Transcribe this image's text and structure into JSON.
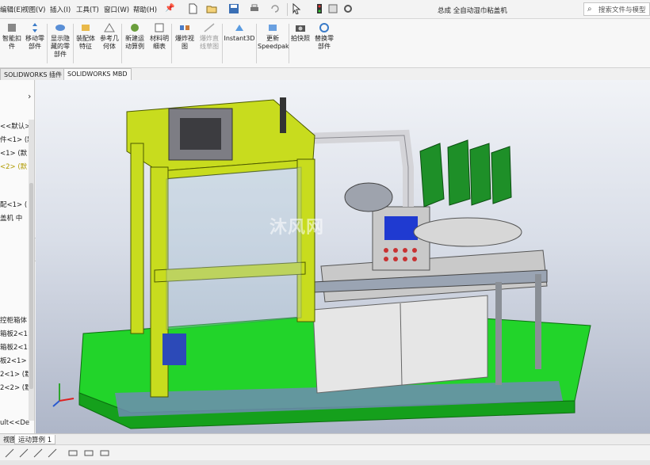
{
  "menu": {
    "items": [
      "编辑(E)",
      "视图(V)",
      "插入(I)",
      "工具(T)",
      "窗口(W)",
      "帮助(H)"
    ]
  },
  "document": {
    "title": "总成  全自动湿巾粘盖机"
  },
  "search": {
    "placeholder": "搜索文件与模型"
  },
  "commands": [
    {
      "label": "智能扣\n件"
    },
    {
      "label": "移动零\n部件"
    },
    {
      "label": "显示隐\n藏的零\n部件"
    },
    {
      "label": "装配体\n特征"
    },
    {
      "label": "参考几\n何体"
    },
    {
      "label": "新建运\n动算例"
    },
    {
      "label": "材料明\n细表"
    },
    {
      "label": "爆炸视\n图"
    },
    {
      "label": "爆炸直\n线草图"
    },
    {
      "label": "Instant3D"
    },
    {
      "label": "更新\nSpeedpak"
    },
    {
      "label": "拍快照"
    },
    {
      "label": "替换零\n部件"
    }
  ],
  "cmd_tabs": [
    "SOLIDWORKS 插件",
    "SOLIDWORKS MBD"
  ],
  "tree": {
    "rows": [
      {
        "text": "<<默认>"
      },
      {
        "text": "件<1> (默"
      },
      {
        "text": "<1> (默"
      },
      {
        "text": "<2> (默"
      },
      {
        "text": "配<1> ("
      },
      {
        "text": "盖机 中"
      },
      {
        "text": "控柜箱体"
      },
      {
        "text": "箱板2<1>"
      },
      {
        "text": "箱板2<1>"
      },
      {
        "text": "板2<1>"
      },
      {
        "text": "2<1> (默"
      },
      {
        "text": "2<2> (默"
      },
      {
        "text": "ult<<De"
      }
    ]
  },
  "bottom_tabs": [
    "视图",
    "运动算例 1"
  ],
  "watermark": "沐风网",
  "colors": {
    "frame_green": "#c8dc1e",
    "base_green": "#22d42a",
    "blue_hint": "#2a6fc9"
  }
}
